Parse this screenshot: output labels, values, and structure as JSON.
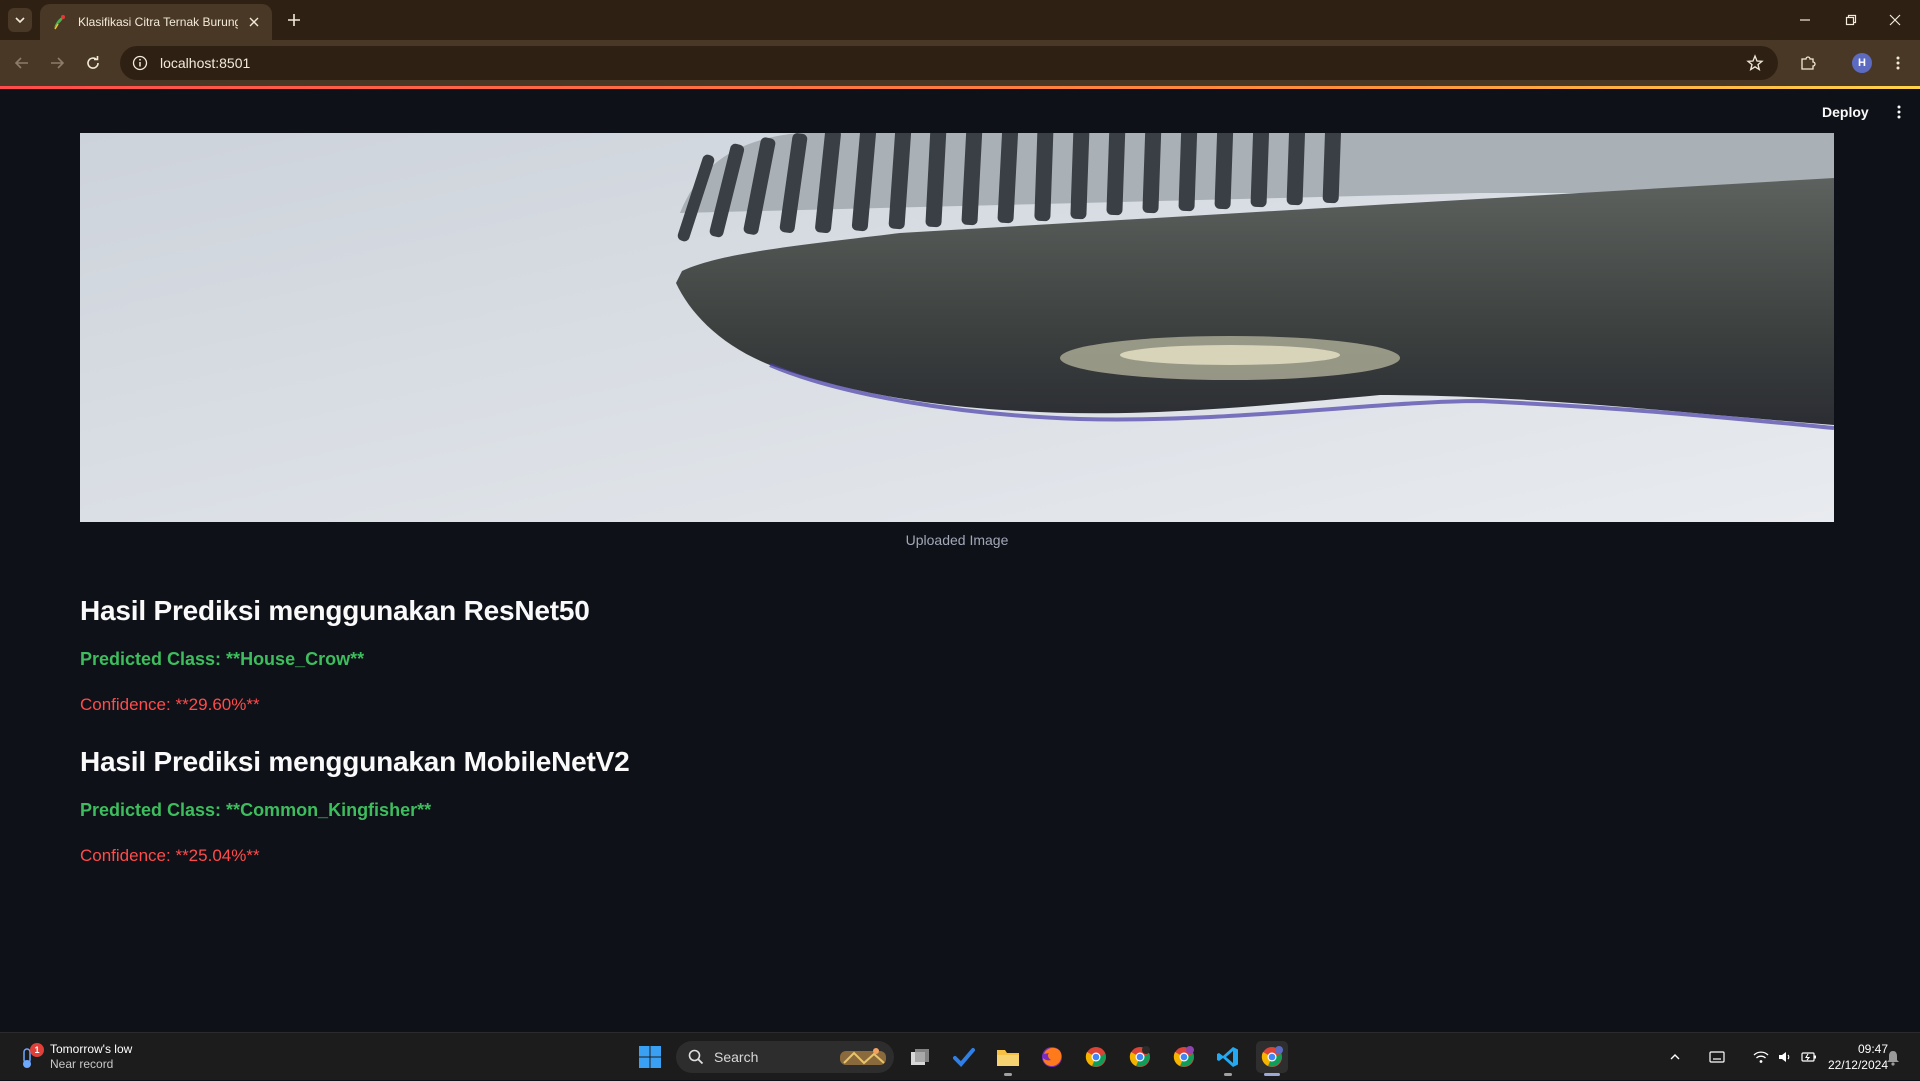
{
  "browser": {
    "tab_title": "Klasifikasi Citra Ternak Burung I",
    "url": "localhost:8501",
    "avatar_letter": "H"
  },
  "app": {
    "deploy_label": "Deploy",
    "image_caption": "Uploaded Image",
    "results": [
      {
        "heading": "Hasil Prediksi menggunakan ResNet50",
        "predicted_class": "Predicted Class: **House_Crow**",
        "confidence": "Confidence: **29.60%**"
      },
      {
        "heading": "Hasil Prediksi menggunakan MobileNetV2",
        "predicted_class": "Predicted Class: **Common_Kingfisher**",
        "confidence": "Confidence: **25.04%**"
      }
    ]
  },
  "taskbar": {
    "weather_title": "Tomorrow's low",
    "weather_subtitle": "Near record",
    "weather_badge": "1",
    "search_label": "Search",
    "clock_time": "09:47",
    "clock_date": "22/12/2024",
    "pinned": [
      "start-icon",
      "task-view-icon",
      "todo-icon",
      "file-explorer-icon",
      "firefox-icon",
      "chrome-icon",
      "chrome-profile-2-icon",
      "chrome-profile-3-icon",
      "vscode-icon",
      "chrome-active-icon"
    ]
  },
  "colors": {
    "app_bg": "#0e1117",
    "success_green": "#3dbd5d",
    "error_red": "#ff4b4b",
    "browser_frame": "#2e2114"
  }
}
